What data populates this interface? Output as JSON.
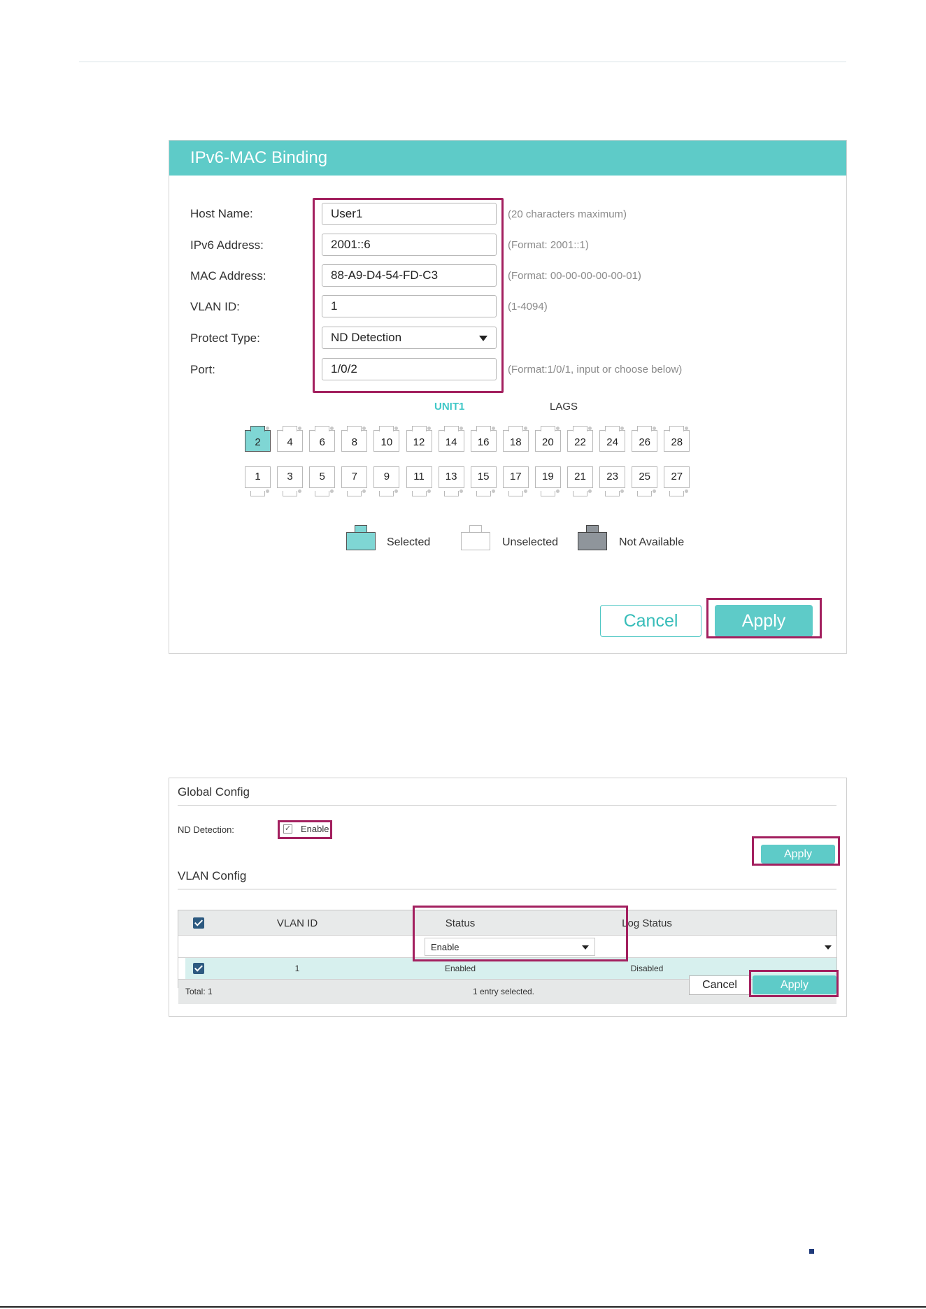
{
  "binding": {
    "title": "IPv6-MAC Binding",
    "fields": {
      "host_name": {
        "label": "Host Name:",
        "value": "User1",
        "hint": "(20 characters maximum)"
      },
      "ipv6_address": {
        "label": "IPv6 Address:",
        "value": "2001::6",
        "hint": "(Format: 2001::1)"
      },
      "mac_address": {
        "label": "MAC Address:",
        "value": "88-A9-D4-54-FD-C3",
        "hint": "(Format: 00-00-00-00-00-01)"
      },
      "vlan_id": {
        "label": "VLAN ID:",
        "value": "1",
        "hint": "(1-4094)"
      },
      "protect_type": {
        "label": "Protect Type:",
        "value": "ND Detection"
      },
      "port": {
        "label": "Port:",
        "value": "1/0/2",
        "hint": "(Format:1/0/1, input or choose below)"
      }
    },
    "tabs": {
      "unit1": "UNIT1",
      "lags": "LAGS"
    },
    "ports_top": [
      "2",
      "4",
      "6",
      "8",
      "10",
      "12",
      "14",
      "16",
      "18",
      "20",
      "22",
      "24",
      "26",
      "28"
    ],
    "ports_bottom": [
      "1",
      "3",
      "5",
      "7",
      "9",
      "11",
      "13",
      "15",
      "17",
      "19",
      "21",
      "23",
      "25",
      "27"
    ],
    "selected_port": "2",
    "legend": {
      "selected": "Selected",
      "unselected": "Unselected",
      "not_available": "Not Available"
    },
    "buttons": {
      "cancel": "Cancel",
      "apply": "Apply"
    },
    "colors": {
      "accent": "#5ecbc8",
      "highlight": "#a3205f",
      "not_available": "#8f959b"
    }
  },
  "global_config": {
    "title": "Global Config",
    "nd_detection_label": "ND Detection:",
    "enable_label": "Enable",
    "enable_checked": true,
    "apply": "Apply"
  },
  "vlan_config": {
    "title": "VLAN Config",
    "columns": {
      "vlan_id": "VLAN ID",
      "status": "Status",
      "log_status": "Log Status"
    },
    "filter": {
      "status": "Enable",
      "log_status": ""
    },
    "rows": [
      {
        "vlan_id": "1",
        "status": "Enabled",
        "log_status": "Disabled"
      }
    ],
    "footer": {
      "total": "Total: 1",
      "selection": "1 entry selected."
    },
    "cancel": "Cancel",
    "apply": "Apply"
  }
}
